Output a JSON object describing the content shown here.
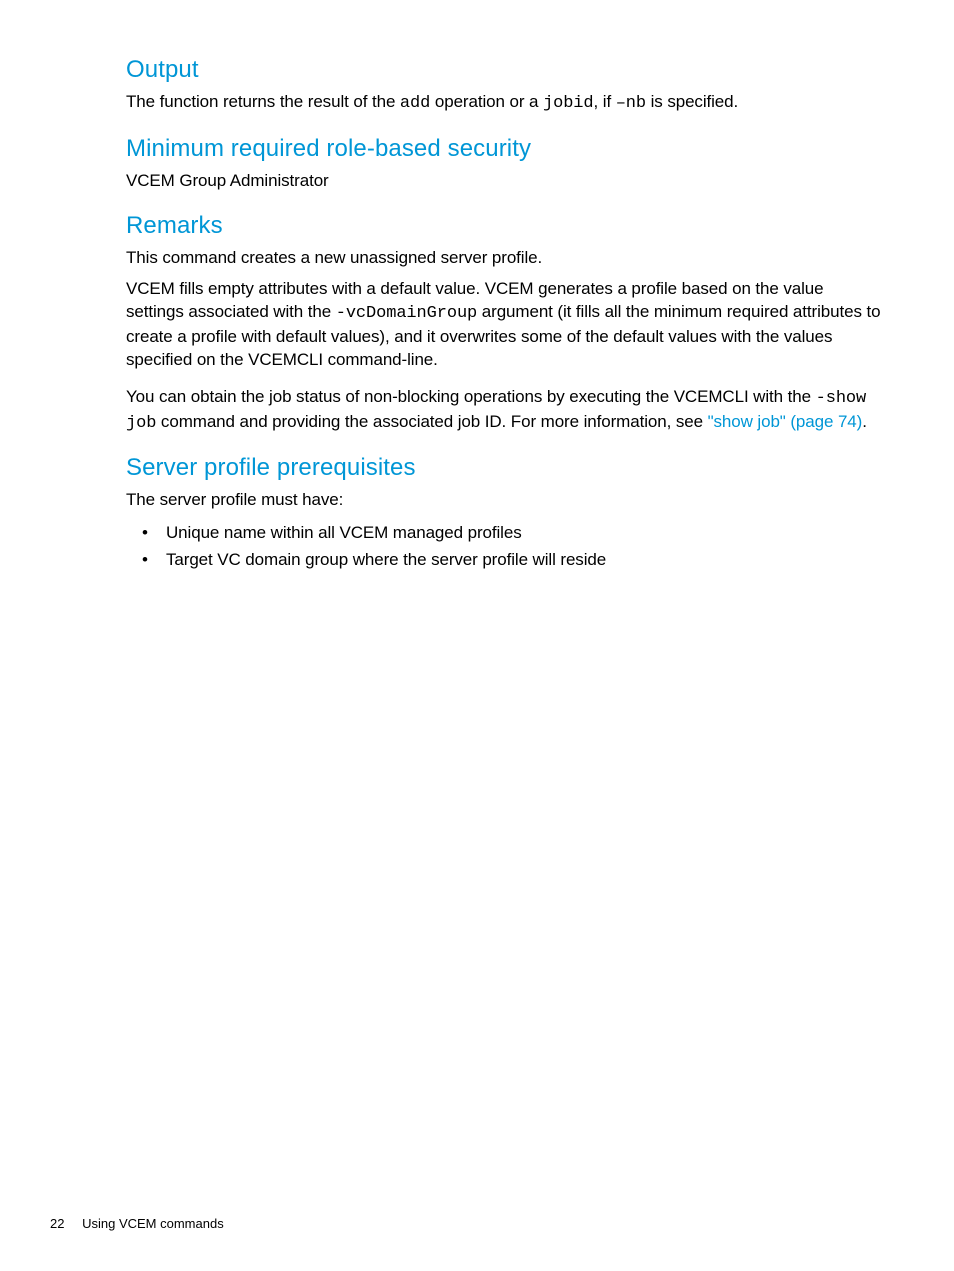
{
  "sections": {
    "output": {
      "heading": "Output",
      "para_parts": {
        "p1a": "The function returns the result of the ",
        "code1": "add",
        "p1b": " operation or a ",
        "code2": "jobid",
        "p1c": ", if ",
        "code3": "–nb",
        "p1d": " is specified."
      }
    },
    "security": {
      "heading": "Minimum required role-based security",
      "para": "VCEM Group Administrator"
    },
    "remarks": {
      "heading": "Remarks",
      "para1": "This command creates a new unassigned server profile.",
      "para2_parts": {
        "a": "VCEM fills empty attributes with a default value. VCEM generates a profile based on the value settings associated with the ",
        "code": "-vcDomainGroup",
        "b": " argument (it fills all the minimum required attributes to create a profile with default values), and it overwrites some of the default values with the values specified on the VCEMCLI command-line."
      },
      "para3_parts": {
        "a": "You can obtain the job status of non-blocking operations by executing the VCEMCLI with the ",
        "code": "-show job",
        "b": " command and providing the associated job ID. For more information, see ",
        "link": "\"show job\" (page 74)",
        "c": "."
      }
    },
    "prereq": {
      "heading": "Server profile prerequisites",
      "intro": "The server profile must have:",
      "items": [
        "Unique name within all VCEM managed profiles",
        "Target VC domain group where the server profile will reside"
      ]
    }
  },
  "footer": {
    "page_number": "22",
    "chapter": "Using VCEM commands"
  }
}
